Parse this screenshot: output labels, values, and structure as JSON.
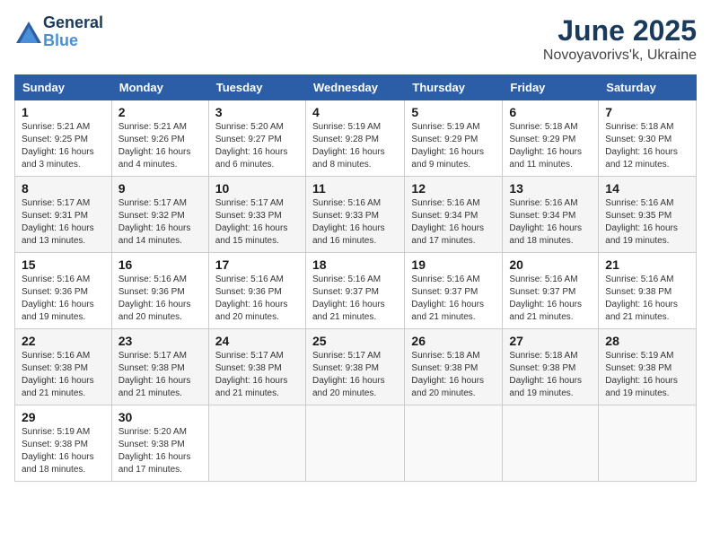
{
  "logo": {
    "line1": "General",
    "line2": "Blue"
  },
  "title": "June 2025",
  "location": "Novoyavorivs'k, Ukraine",
  "weekdays": [
    "Sunday",
    "Monday",
    "Tuesday",
    "Wednesday",
    "Thursday",
    "Friday",
    "Saturday"
  ],
  "weeks": [
    [
      {
        "day": "1",
        "sunrise": "Sunrise: 5:21 AM",
        "sunset": "Sunset: 9:25 PM",
        "daylight": "Daylight: 16 hours and 3 minutes."
      },
      {
        "day": "2",
        "sunrise": "Sunrise: 5:21 AM",
        "sunset": "Sunset: 9:26 PM",
        "daylight": "Daylight: 16 hours and 4 minutes."
      },
      {
        "day": "3",
        "sunrise": "Sunrise: 5:20 AM",
        "sunset": "Sunset: 9:27 PM",
        "daylight": "Daylight: 16 hours and 6 minutes."
      },
      {
        "day": "4",
        "sunrise": "Sunrise: 5:19 AM",
        "sunset": "Sunset: 9:28 PM",
        "daylight": "Daylight: 16 hours and 8 minutes."
      },
      {
        "day": "5",
        "sunrise": "Sunrise: 5:19 AM",
        "sunset": "Sunset: 9:29 PM",
        "daylight": "Daylight: 16 hours and 9 minutes."
      },
      {
        "day": "6",
        "sunrise": "Sunrise: 5:18 AM",
        "sunset": "Sunset: 9:29 PM",
        "daylight": "Daylight: 16 hours and 11 minutes."
      },
      {
        "day": "7",
        "sunrise": "Sunrise: 5:18 AM",
        "sunset": "Sunset: 9:30 PM",
        "daylight": "Daylight: 16 hours and 12 minutes."
      }
    ],
    [
      {
        "day": "8",
        "sunrise": "Sunrise: 5:17 AM",
        "sunset": "Sunset: 9:31 PM",
        "daylight": "Daylight: 16 hours and 13 minutes."
      },
      {
        "day": "9",
        "sunrise": "Sunrise: 5:17 AM",
        "sunset": "Sunset: 9:32 PM",
        "daylight": "Daylight: 16 hours and 14 minutes."
      },
      {
        "day": "10",
        "sunrise": "Sunrise: 5:17 AM",
        "sunset": "Sunset: 9:33 PM",
        "daylight": "Daylight: 16 hours and 15 minutes."
      },
      {
        "day": "11",
        "sunrise": "Sunrise: 5:16 AM",
        "sunset": "Sunset: 9:33 PM",
        "daylight": "Daylight: 16 hours and 16 minutes."
      },
      {
        "day": "12",
        "sunrise": "Sunrise: 5:16 AM",
        "sunset": "Sunset: 9:34 PM",
        "daylight": "Daylight: 16 hours and 17 minutes."
      },
      {
        "day": "13",
        "sunrise": "Sunrise: 5:16 AM",
        "sunset": "Sunset: 9:34 PM",
        "daylight": "Daylight: 16 hours and 18 minutes."
      },
      {
        "day": "14",
        "sunrise": "Sunrise: 5:16 AM",
        "sunset": "Sunset: 9:35 PM",
        "daylight": "Daylight: 16 hours and 19 minutes."
      }
    ],
    [
      {
        "day": "15",
        "sunrise": "Sunrise: 5:16 AM",
        "sunset": "Sunset: 9:36 PM",
        "daylight": "Daylight: 16 hours and 19 minutes."
      },
      {
        "day": "16",
        "sunrise": "Sunrise: 5:16 AM",
        "sunset": "Sunset: 9:36 PM",
        "daylight": "Daylight: 16 hours and 20 minutes."
      },
      {
        "day": "17",
        "sunrise": "Sunrise: 5:16 AM",
        "sunset": "Sunset: 9:36 PM",
        "daylight": "Daylight: 16 hours and 20 minutes."
      },
      {
        "day": "18",
        "sunrise": "Sunrise: 5:16 AM",
        "sunset": "Sunset: 9:37 PM",
        "daylight": "Daylight: 16 hours and 21 minutes."
      },
      {
        "day": "19",
        "sunrise": "Sunrise: 5:16 AM",
        "sunset": "Sunset: 9:37 PM",
        "daylight": "Daylight: 16 hours and 21 minutes."
      },
      {
        "day": "20",
        "sunrise": "Sunrise: 5:16 AM",
        "sunset": "Sunset: 9:37 PM",
        "daylight": "Daylight: 16 hours and 21 minutes."
      },
      {
        "day": "21",
        "sunrise": "Sunrise: 5:16 AM",
        "sunset": "Sunset: 9:38 PM",
        "daylight": "Daylight: 16 hours and 21 minutes."
      }
    ],
    [
      {
        "day": "22",
        "sunrise": "Sunrise: 5:16 AM",
        "sunset": "Sunset: 9:38 PM",
        "daylight": "Daylight: 16 hours and 21 minutes."
      },
      {
        "day": "23",
        "sunrise": "Sunrise: 5:17 AM",
        "sunset": "Sunset: 9:38 PM",
        "daylight": "Daylight: 16 hours and 21 minutes."
      },
      {
        "day": "24",
        "sunrise": "Sunrise: 5:17 AM",
        "sunset": "Sunset: 9:38 PM",
        "daylight": "Daylight: 16 hours and 21 minutes."
      },
      {
        "day": "25",
        "sunrise": "Sunrise: 5:17 AM",
        "sunset": "Sunset: 9:38 PM",
        "daylight": "Daylight: 16 hours and 20 minutes."
      },
      {
        "day": "26",
        "sunrise": "Sunrise: 5:18 AM",
        "sunset": "Sunset: 9:38 PM",
        "daylight": "Daylight: 16 hours and 20 minutes."
      },
      {
        "day": "27",
        "sunrise": "Sunrise: 5:18 AM",
        "sunset": "Sunset: 9:38 PM",
        "daylight": "Daylight: 16 hours and 19 minutes."
      },
      {
        "day": "28",
        "sunrise": "Sunrise: 5:19 AM",
        "sunset": "Sunset: 9:38 PM",
        "daylight": "Daylight: 16 hours and 19 minutes."
      }
    ],
    [
      {
        "day": "29",
        "sunrise": "Sunrise: 5:19 AM",
        "sunset": "Sunset: 9:38 PM",
        "daylight": "Daylight: 16 hours and 18 minutes."
      },
      {
        "day": "30",
        "sunrise": "Sunrise: 5:20 AM",
        "sunset": "Sunset: 9:38 PM",
        "daylight": "Daylight: 16 hours and 17 minutes."
      },
      null,
      null,
      null,
      null,
      null
    ]
  ]
}
